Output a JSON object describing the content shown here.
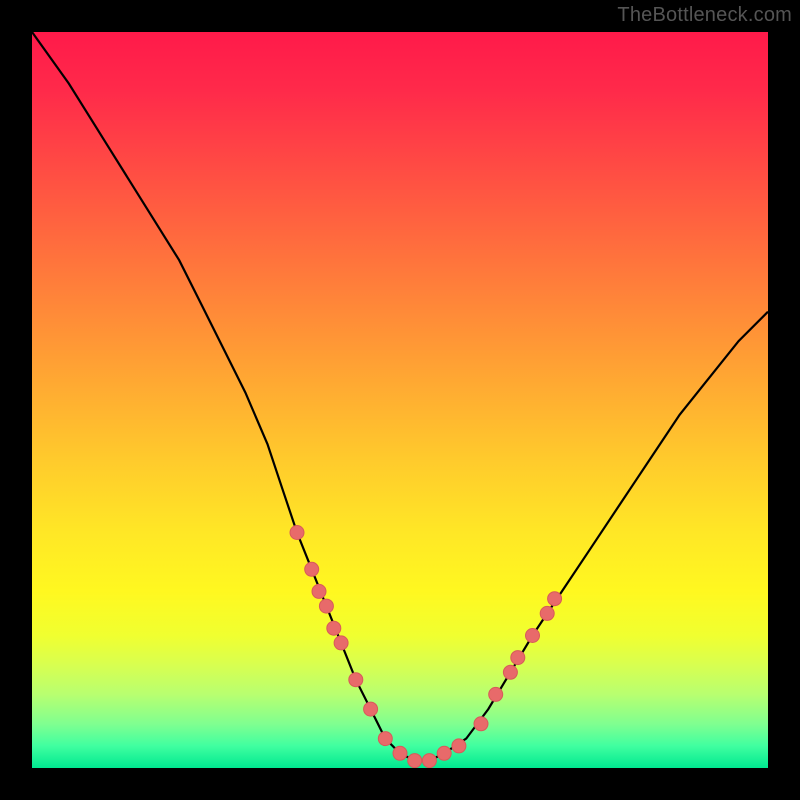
{
  "watermark": "TheBottleneck.com",
  "colors": {
    "background": "#000000",
    "curve_stroke": "#000000",
    "marker_fill": "#e86a6a",
    "marker_stroke": "#d85a5a"
  },
  "chart_data": {
    "type": "line",
    "title": "",
    "xlabel": "",
    "ylabel": "",
    "xlim": [
      0,
      100
    ],
    "ylim": [
      0,
      100
    ],
    "gradient_meaning": "vertical heat gradient from red (top / high bottleneck) to green (bottom / low bottleneck)",
    "series": [
      {
        "name": "bottleneck-curve",
        "x": [
          0,
          5,
          10,
          15,
          20,
          23,
          26,
          29,
          32,
          34,
          36,
          38,
          40,
          42,
          44,
          46,
          48,
          50,
          52,
          54,
          56,
          59,
          62,
          65,
          68,
          72,
          76,
          80,
          84,
          88,
          92,
          96,
          100
        ],
        "y": [
          100,
          93,
          85,
          77,
          69,
          63,
          57,
          51,
          44,
          38,
          32,
          27,
          22,
          17,
          12,
          8,
          4,
          2,
          1,
          1,
          2,
          4,
          8,
          13,
          18,
          24,
          30,
          36,
          42,
          48,
          53,
          58,
          62
        ]
      }
    ],
    "markers": {
      "name": "highlighted-points",
      "note": "red bead-like markers clustered near the trough of the curve",
      "points": [
        {
          "x": 36,
          "y": 32
        },
        {
          "x": 38,
          "y": 27
        },
        {
          "x": 39,
          "y": 24
        },
        {
          "x": 40,
          "y": 22
        },
        {
          "x": 41,
          "y": 19
        },
        {
          "x": 42,
          "y": 17
        },
        {
          "x": 44,
          "y": 12
        },
        {
          "x": 46,
          "y": 8
        },
        {
          "x": 48,
          "y": 4
        },
        {
          "x": 50,
          "y": 2
        },
        {
          "x": 52,
          "y": 1
        },
        {
          "x": 54,
          "y": 1
        },
        {
          "x": 56,
          "y": 2
        },
        {
          "x": 58,
          "y": 3
        },
        {
          "x": 61,
          "y": 6
        },
        {
          "x": 63,
          "y": 10
        },
        {
          "x": 65,
          "y": 13
        },
        {
          "x": 66,
          "y": 15
        },
        {
          "x": 68,
          "y": 18
        },
        {
          "x": 70,
          "y": 21
        },
        {
          "x": 71,
          "y": 23
        }
      ]
    }
  }
}
